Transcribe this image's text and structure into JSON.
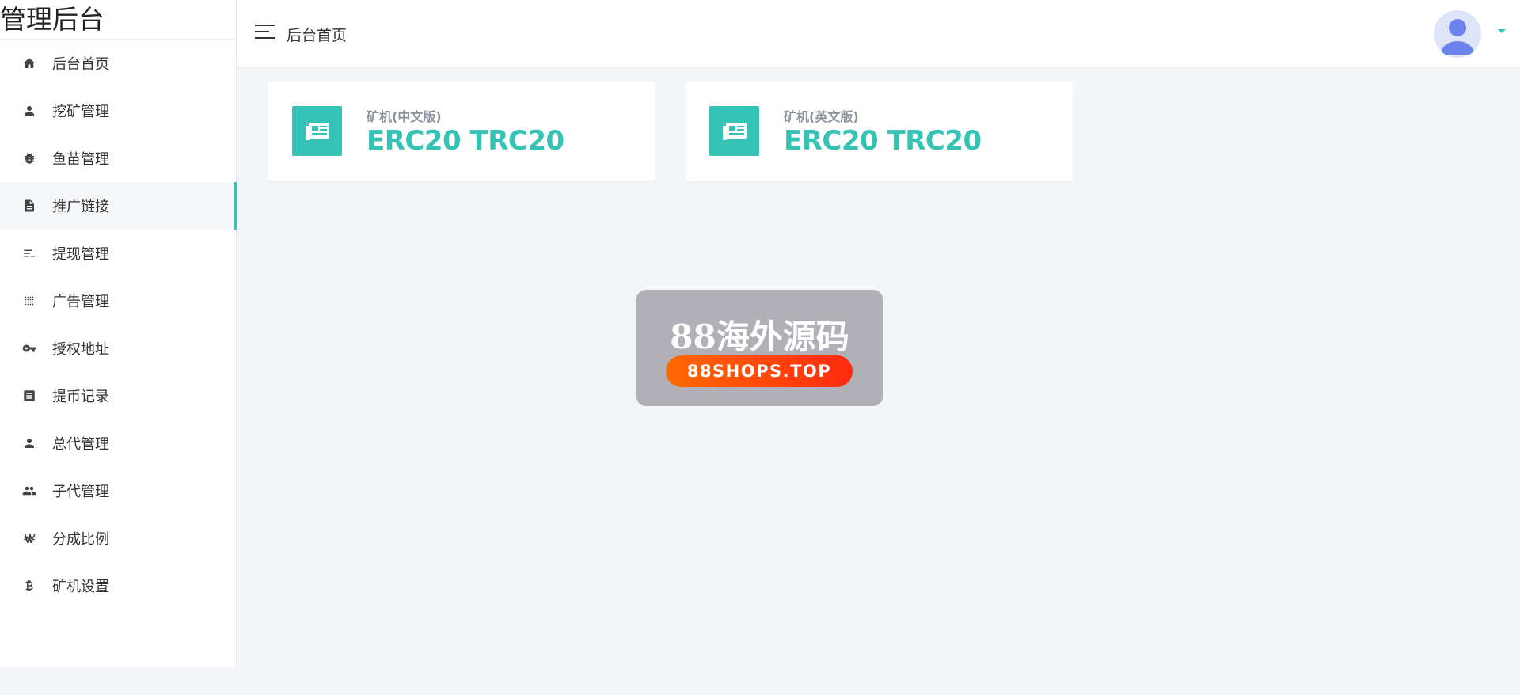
{
  "sidebar": {
    "brand": "管理后台",
    "items": [
      {
        "label": "后台首页",
        "icon": "home-icon"
      },
      {
        "label": "挖矿管理",
        "icon": "person-icon"
      },
      {
        "label": "鱼苗管理",
        "icon": "bug-icon"
      },
      {
        "label": "推广链接",
        "icon": "document-icon",
        "active": true
      },
      {
        "label": "提现管理",
        "icon": "list-icon"
      },
      {
        "label": "广告管理",
        "icon": "grid-dots-icon"
      },
      {
        "label": "授权地址",
        "icon": "key-icon"
      },
      {
        "label": "提币记录",
        "icon": "record-icon"
      },
      {
        "label": "总代管理",
        "icon": "person-icon"
      },
      {
        "label": "子代管理",
        "icon": "people-icon"
      },
      {
        "label": "分成比例",
        "icon": "won-icon"
      },
      {
        "label": "矿机设置",
        "icon": "bitcoin-icon"
      }
    ]
  },
  "header": {
    "title": "后台首页"
  },
  "cards": [
    {
      "label": "矿机(中文版)",
      "value": "ERC20 TRC20"
    },
    {
      "label": "矿机(英文版)",
      "value": "ERC20 TRC20"
    }
  ],
  "watermark": {
    "title": "88海外源码",
    "url": "88SHOPS.TOP"
  },
  "colors": {
    "accent": "#34c3b4",
    "background": "#f4f5f9"
  }
}
